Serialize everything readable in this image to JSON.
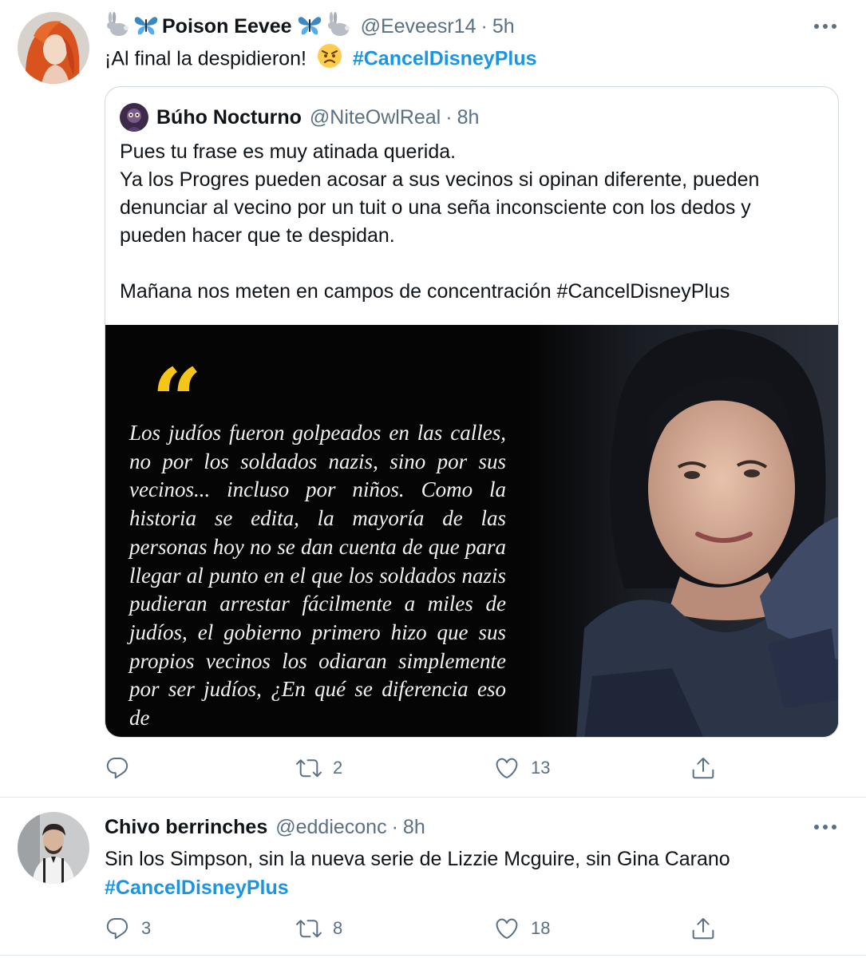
{
  "tweets": [
    {
      "name": "Poison Eevee",
      "handle": "@Eeveesr14",
      "time": "5h",
      "text": "¡Al final la despidieron!",
      "hashtag": "#CancelDisneyPlus",
      "quoted": {
        "name": "Búho Nocturno",
        "handle": "@NiteOwlReal",
        "time": "8h",
        "lines": [
          "Pues tu frase es muy atinada querida.",
          "Ya los Progres pueden acosar a sus vecinos si opinan diferente, pueden",
          "denunciar al vecino por un tuit o una seña inconsciente con los dedos y",
          "pueden hacer que te despidan.",
          "",
          "Mañana nos meten en campos de concentración #CancelDisneyPlus"
        ],
        "image_quote_mark": "“",
        "image_text": "Los judíos fueron golpeados en las calles, no por los soldados nazis, sino por sus vecinos... incluso por niños. Como la historia se edita, la mayoría de las personas hoy no se dan cuenta de que para llegar al punto en el que los soldados nazis pudieran arrestar fácilmente a miles de judíos, el gobierno primero hizo que sus propios vecinos los odiaran simplemente por ser judíos, ¿En qué se diferencia eso de"
      },
      "actions": {
        "reply": "",
        "retweet": "2",
        "like": "13"
      }
    },
    {
      "name": "Chivo berrinches",
      "handle": "@eddieconc",
      "time": "8h",
      "text": "Sin los Simpson, sin la nueva serie de Lizzie Mcguire, sin Gina Carano",
      "hashtag": "#CancelDisneyPlus",
      "actions": {
        "reply": "3",
        "retweet": "8",
        "like": "18"
      }
    }
  ],
  "colors": {
    "accent": "#1b95e0",
    "secondary": "#5b7083",
    "border": "#cfd9de",
    "quote_mark": "#f5c518"
  },
  "icons": [
    "rabbit-icon",
    "butterfly-icon",
    "angry-face-icon",
    "more-icon",
    "reply-icon",
    "retweet-icon",
    "like-icon",
    "share-icon"
  ]
}
